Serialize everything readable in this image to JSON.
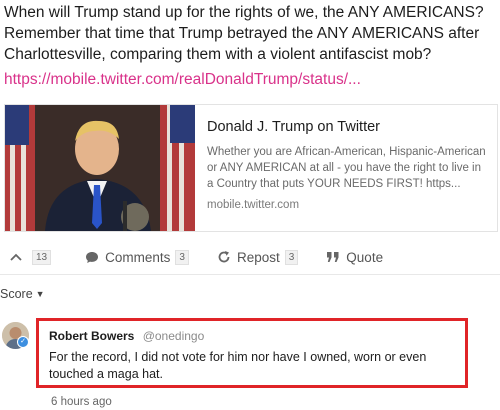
{
  "post": {
    "text": "When will Trump stand up for the rights of we, the ANY AMERICANS? Remember that time that Trump betrayed the ANY AMERICANS after Charlottesville, comparing them with a violent antifascist mob?",
    "link": "https://mobile.twitter.com/realDonaldTrump/status/..."
  },
  "card": {
    "title": "Donald J. Trump on Twitter",
    "description": "Whether you are African-American, Hispanic-American or ANY AMERICAN at all - you have the right to live in a Country that puts YOUR NEEDS FIRST! https...",
    "domain": "mobile.twitter.com"
  },
  "actions": {
    "vote_icon": "upvote-chevron-icon",
    "vote_count": "13",
    "comments_label": "Comments",
    "comments_count": "3",
    "repost_label": "Repost",
    "repost_count": "3",
    "quote_label": "Quote"
  },
  "sort": {
    "label": "Score"
  },
  "comment": {
    "author": "Robert Bowers",
    "handle": "@onedingo",
    "text": "For the record, I did not vote for him nor have I owned, worn or even touched a maga hat.",
    "time": "6 hours ago"
  },
  "colors": {
    "link": "#d9328a",
    "highlight_border": "#e02428",
    "verified": "#3d8fe0"
  }
}
